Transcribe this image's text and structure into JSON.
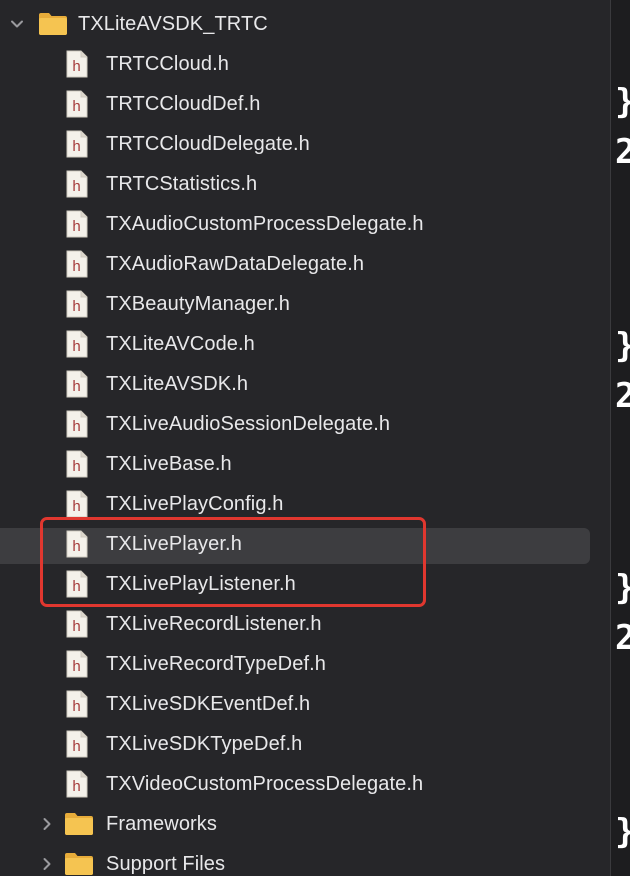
{
  "navigator": {
    "root_folder": {
      "label": "TXLiteAVSDK_TRTC",
      "expanded": true
    },
    "file_badge": "h",
    "files": [
      {
        "label": "TRTCCloud.h"
      },
      {
        "label": "TRTCCloudDef.h"
      },
      {
        "label": "TRTCCloudDelegate.h"
      },
      {
        "label": "TRTCStatistics.h"
      },
      {
        "label": "TXAudioCustomProcessDelegate.h"
      },
      {
        "label": "TXAudioRawDataDelegate.h"
      },
      {
        "label": "TXBeautyManager.h"
      },
      {
        "label": "TXLiteAVCode.h"
      },
      {
        "label": "TXLiteAVSDK.h"
      },
      {
        "label": "TXLiveAudioSessionDelegate.h"
      },
      {
        "label": "TXLiveBase.h"
      },
      {
        "label": "TXLivePlayConfig.h"
      },
      {
        "label": "TXLivePlayer.h",
        "selected": true
      },
      {
        "label": "TXLivePlayListener.h"
      },
      {
        "label": "TXLiveRecordListener.h"
      },
      {
        "label": "TXLiveRecordTypeDef.h"
      },
      {
        "label": "TXLiveSDKEventDef.h"
      },
      {
        "label": "TXLiveSDKTypeDef.h"
      },
      {
        "label": "TXVideoCustomProcessDelegate.h"
      }
    ],
    "subfolders": [
      {
        "label": "Frameworks",
        "expanded": false
      },
      {
        "label": "Support Files",
        "expanded": false
      }
    ]
  },
  "annotation": {
    "color": "#e0372f",
    "highlighted_files": [
      "TXLivePlayer.h",
      "TXLivePlayListener.h"
    ]
  },
  "editor_glyphs": [
    "}",
    "2",
    "}",
    "2",
    "}",
    "2",
    "}"
  ],
  "colors": {
    "background": "#262629",
    "selection": "#3d3d40",
    "text": "#e8e8ea",
    "folder": "#f2c14b",
    "file_badge": "#a53a3a"
  },
  "icons": {
    "disclosure_expanded": "chevron-down-icon",
    "disclosure_collapsed": "chevron-right-icon",
    "folder": "folder-icon",
    "header_file": "header-file-icon"
  }
}
